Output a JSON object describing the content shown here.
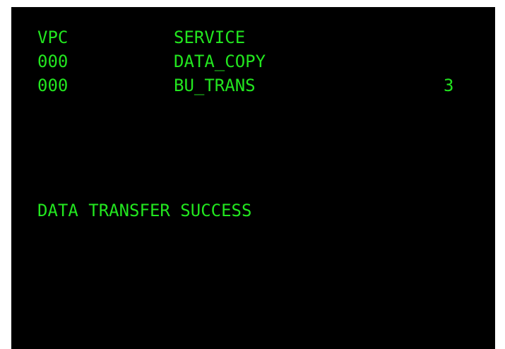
{
  "terminal": {
    "text_color": "#22e61f",
    "background_color": "#000000",
    "header": {
      "col1": "VPC",
      "col2": "SERVICE"
    },
    "rows": [
      {
        "vpc": "000",
        "service": "DATA_COPY",
        "count": ""
      },
      {
        "vpc": "000",
        "service": "BU_TRANS",
        "count": "3"
      }
    ],
    "status_message": "DATA TRANSFER SUCCESS"
  }
}
